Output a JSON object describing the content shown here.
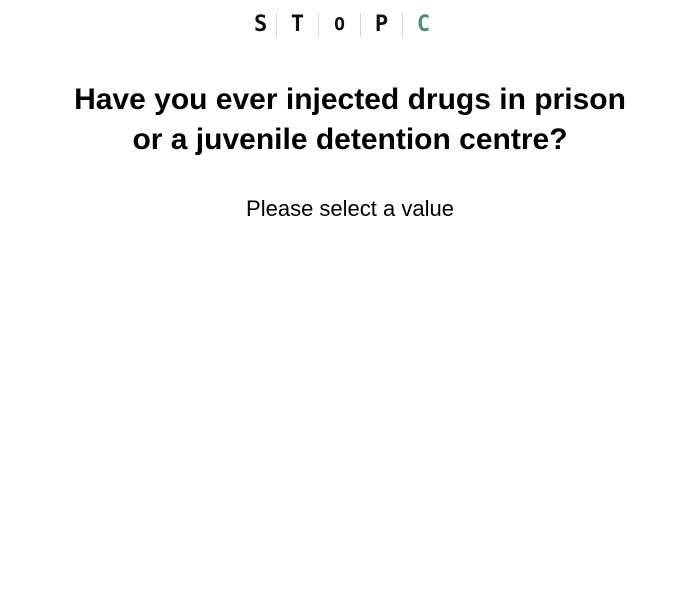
{
  "logo": {
    "letters": [
      "S",
      "T",
      "O",
      "P",
      "C"
    ],
    "accent_color": "#4f8f7f"
  },
  "question": {
    "text": "Have you ever injected drugs in prison\nor a juvenile detention centre?"
  },
  "prompt": {
    "text": "Please select a value"
  }
}
